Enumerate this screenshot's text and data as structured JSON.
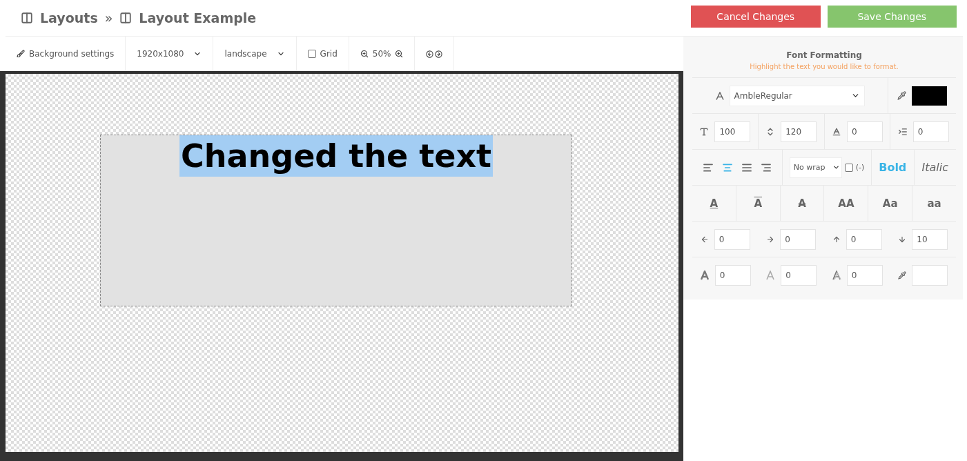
{
  "breadcrumb": {
    "items": [
      "Layouts",
      "Layout Example"
    ],
    "separator": "»"
  },
  "actions": [
    {
      "label": "Cancel Changes",
      "kind": "cancel"
    },
    {
      "label": "Save Changes",
      "kind": "save"
    }
  ],
  "toolbar": {
    "background": "Background settings",
    "resolution": "1920x1080",
    "orientation": "landscape",
    "grid": {
      "label": "Grid",
      "checked": false
    },
    "zoom": "50%"
  },
  "canvas": {
    "text": "Changed the text",
    "highlighted": true
  },
  "panel": {
    "title": "Font Formatting",
    "hint": "Highlight the text you would like to format.",
    "font": "AmbleRegular",
    "color": "#000000",
    "metrics": [
      {
        "kind": "size",
        "value": "100"
      },
      {
        "kind": "line-height",
        "value": "120"
      },
      {
        "kind": "letter-spacing",
        "value": "0"
      },
      {
        "kind": "indent",
        "value": "0"
      }
    ],
    "align": [
      {
        "kind": "left",
        "selected": false
      },
      {
        "kind": "center",
        "selected": true
      },
      {
        "kind": "justify",
        "selected": false
      },
      {
        "kind": "right",
        "selected": false
      }
    ],
    "wrap": "No wrap",
    "hyphen": {
      "label": "(-)",
      "checked": false
    },
    "styles": [
      {
        "label": "Bold",
        "kind": "bold",
        "selected": true
      },
      {
        "label": "Italic",
        "kind": "italic",
        "selected": false
      }
    ],
    "decorations": [
      {
        "label": "A",
        "kind": "underline"
      },
      {
        "label": "A",
        "kind": "overline"
      },
      {
        "label": "A",
        "kind": "strike"
      }
    ],
    "cases": [
      "AA",
      "Aa",
      "aa"
    ],
    "offsets": [
      {
        "kind": "left",
        "value": "0"
      },
      {
        "kind": "right",
        "value": "0"
      },
      {
        "kind": "up",
        "value": "0"
      },
      {
        "kind": "down",
        "value": "10"
      }
    ],
    "effects": [
      {
        "kind": "outline",
        "value": "0"
      },
      {
        "kind": "blur",
        "value": "0"
      },
      {
        "kind": "shadow",
        "value": "0"
      }
    ]
  }
}
